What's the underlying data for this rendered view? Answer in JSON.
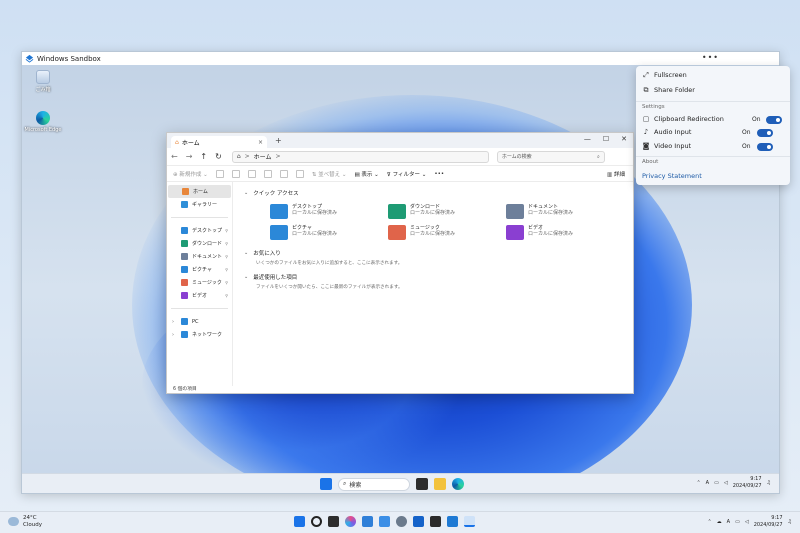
{
  "sandbox": {
    "title": "Windows Sandbox",
    "more": "•••"
  },
  "desktop_icons": [
    {
      "label": "ごみ箱"
    },
    {
      "label": "Microsoft Edge"
    }
  ],
  "explorer": {
    "tab_label": "ホーム",
    "tab_close": "×",
    "new_tab": "+",
    "window_controls": {
      "minimize": "—",
      "maximize": "☐",
      "close": "✕"
    },
    "address": {
      "crumb": "ホーム",
      "sep": ">"
    },
    "search_placeholder": "ホームの検索",
    "commands": {
      "new": "新規作成",
      "sort": "並べ替え",
      "view": "表示",
      "filter": "フィルター",
      "more": "•••",
      "details": "詳細"
    },
    "nav": {
      "top": [
        {
          "label": "ホーム",
          "color": "#e8863a"
        },
        {
          "label": "ギャラリー",
          "color": "#2f8fd8"
        }
      ],
      "pinned": [
        {
          "label": "デスクトップ",
          "color": "#2b88d8"
        },
        {
          "label": "ダウンロード",
          "color": "#1e9b74"
        },
        {
          "label": "ドキュメント",
          "color": "#6d7f9a"
        },
        {
          "label": "ピクチャ",
          "color": "#2b88d8"
        },
        {
          "label": "ミュージック",
          "color": "#e0644a"
        },
        {
          "label": "ビデオ",
          "color": "#8a3fd1"
        }
      ],
      "bottom": [
        {
          "label": "PC",
          "color": "#2b88d8"
        },
        {
          "label": "ネットワーク",
          "color": "#2b88d8"
        }
      ]
    },
    "quick_access_title": "クイック アクセス",
    "quick_access": [
      {
        "name": "デスクトップ",
        "sub": "ローカルに保存済み",
        "color": "#2b88d8"
      },
      {
        "name": "ダウンロード",
        "sub": "ローカルに保存済み",
        "color": "#1e9b74"
      },
      {
        "name": "ドキュメント",
        "sub": "ローカルに保存済み",
        "color": "#6d7f9a"
      },
      {
        "name": "ピクチャ",
        "sub": "ローカルに保存済み",
        "color": "#2b88d8"
      },
      {
        "name": "ミュージック",
        "sub": "ローカルに保存済み",
        "color": "#e0644a"
      },
      {
        "name": "ビデオ",
        "sub": "ローカルに保存済み",
        "color": "#8a3fd1"
      }
    ],
    "favorites_title": "お気に入り",
    "favorites_text": "いくつかのファイルをお気に入りに追加すると、ここに表示されます。",
    "recent_title": "最近使用した項目",
    "recent_text": "ファイルをいくつか開いたら、ここに最新のファイルが表示されます。",
    "status": "6 個の項目"
  },
  "sandbox_taskbar": {
    "search_label": "検索",
    "time": "9:17",
    "date": "2024/09/27",
    "lang": "A"
  },
  "flyout": {
    "fullscreen": "Fullscreen",
    "share_folder": "Share Folder",
    "settings_label": "Settings",
    "clipboard": "Clipboard Redirection",
    "audio": "Audio Input",
    "video": "Video Input",
    "on": "On",
    "about_label": "About",
    "privacy": "Privacy Statement"
  },
  "host_taskbar": {
    "weather_temp": "24°C",
    "weather_desc": "Cloudy",
    "time": "9:17",
    "date": "2024/09/27",
    "lang": "A"
  },
  "colors": {
    "accent": "#1f5eb8",
    "bloom": "#1c4fd6"
  }
}
